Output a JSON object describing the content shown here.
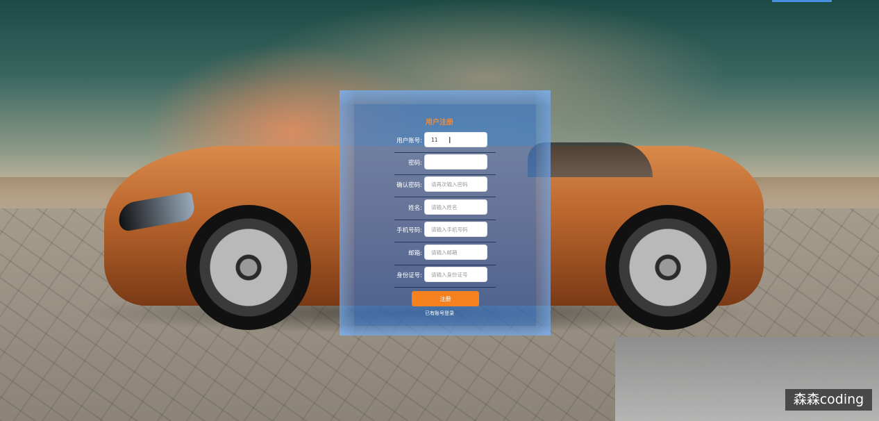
{
  "form": {
    "title": "用户注册",
    "fields": [
      {
        "label": "用户账号:",
        "value": "11",
        "placeholder": ""
      },
      {
        "label": "密码:",
        "value": "",
        "placeholder": ""
      },
      {
        "label": "确认密码:",
        "value": "",
        "placeholder": "请再次输入密码"
      },
      {
        "label": "姓名:",
        "value": "",
        "placeholder": "请输入姓名"
      },
      {
        "label": "手机号码:",
        "value": "",
        "placeholder": "请输入手机号码"
      },
      {
        "label": "邮箱:",
        "value": "",
        "placeholder": "请输入邮箱"
      },
      {
        "label": "身份证号:",
        "value": "",
        "placeholder": "请输入身份证号"
      }
    ],
    "register_button": "注册",
    "login_link": "已有账号登录"
  },
  "watermark": "森森coding",
  "colors": {
    "accent_orange": "#f5821f",
    "panel_blue": "#4682d2",
    "title_orange": "#f28a3a"
  }
}
